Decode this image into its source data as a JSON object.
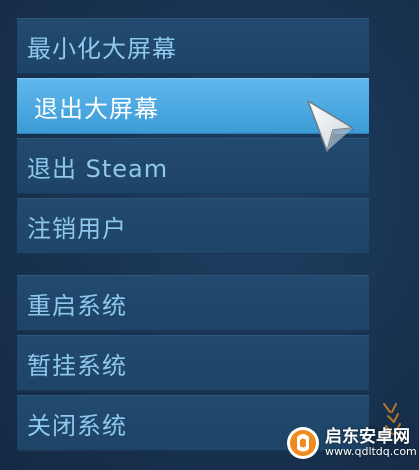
{
  "menu": {
    "groups": [
      {
        "items": [
          {
            "label": "最小化大屏幕",
            "selected": false
          },
          {
            "label": "退出大屏幕",
            "selected": true
          },
          {
            "label": "退出 Steam",
            "selected": false
          },
          {
            "label": "注销用户",
            "selected": false
          }
        ]
      },
      {
        "items": [
          {
            "label": "重启系统",
            "selected": false
          },
          {
            "label": "暂挂系统",
            "selected": false
          },
          {
            "label": "关闭系统",
            "selected": false
          }
        ]
      }
    ]
  },
  "watermark": {
    "title": "启东安卓网",
    "url": "www.qdltdq.com"
  },
  "colors": {
    "item_bg": "#224a6f",
    "item_text": "#8ec8ec",
    "selected_bg": "#4aa7e0",
    "selected_text": "#ffffff",
    "background": "#183250"
  },
  "icons": {
    "cursor": "arrow-cursor-icon",
    "watermark_logo": "watermark-logo-icon"
  }
}
